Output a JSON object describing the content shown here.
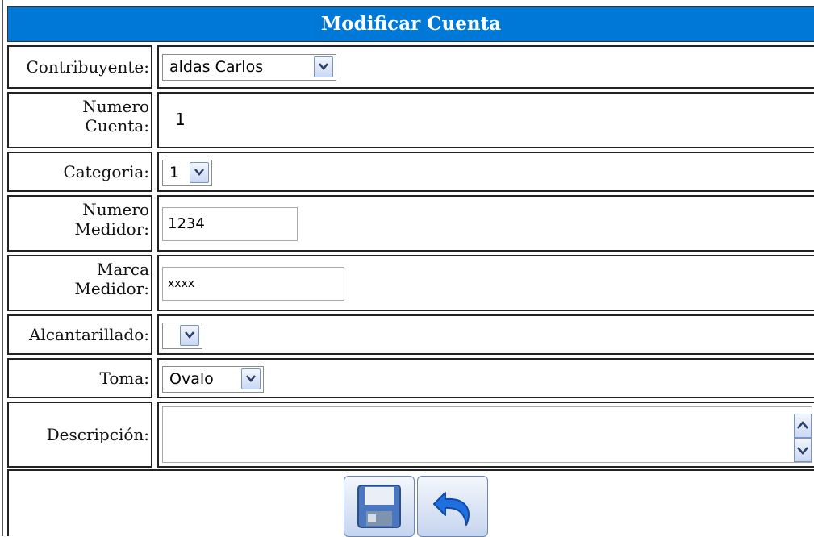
{
  "header": {
    "title": "Modificar Cuenta"
  },
  "form": {
    "contribuyente": {
      "label": "Contribuyente:",
      "value": "aldas Carlos"
    },
    "numero_cuenta": {
      "label_line1": "Numero",
      "label_line2": "Cuenta:",
      "value": "1"
    },
    "categoria": {
      "label": "Categoria:",
      "value": "1"
    },
    "numero_medidor": {
      "label_line1": "Numero",
      "label_line2": "Medidor:",
      "value": "1234"
    },
    "marca_medidor": {
      "label_line1": "Marca",
      "label_line2": "Medidor:",
      "value": "xxxx"
    },
    "alcantarillado": {
      "label": "Alcantarillado:",
      "value": ""
    },
    "toma": {
      "label": "Toma:",
      "value": "Ovalo"
    },
    "descripcion": {
      "label": "Descripción:",
      "value": ""
    }
  },
  "actions": {
    "save_icon": "floppy-disk-icon",
    "undo_icon": "undo-arrow-icon"
  },
  "colors": {
    "header_bg": "#0078d7",
    "header_text": "#ffffff"
  }
}
